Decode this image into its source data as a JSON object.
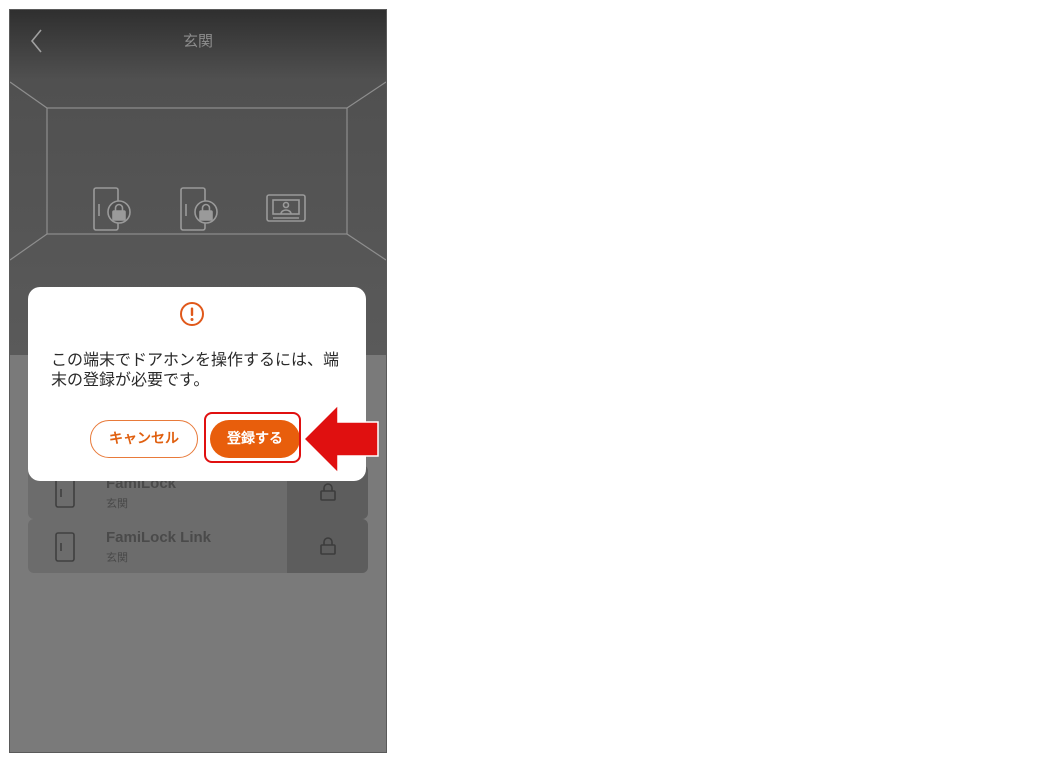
{
  "header": {
    "title": "玄関",
    "back_icon": "chevron-left-icon"
  },
  "room": {
    "devices": [
      {
        "icon": "door-lock-icon"
      },
      {
        "icon": "door-lock-icon"
      },
      {
        "icon": "intercom-monitor-icon"
      }
    ]
  },
  "device_list": [
    {
      "name": "FamiLock",
      "location": "玄関",
      "action_icon": "lock-icon"
    },
    {
      "name": "FamiLock Link",
      "location": "玄関",
      "action_icon": "lock-icon"
    }
  ],
  "dialog": {
    "icon": "warning-icon",
    "message": "この端末でドアホンを操作するには、端末の登録が必要です。",
    "cancel_label": "キャンセル",
    "confirm_label": "登録する"
  },
  "annotation": {
    "highlight_color": "#e01010",
    "arrow_color": "#e01010"
  },
  "colors": {
    "accent": "#e85e0c"
  }
}
